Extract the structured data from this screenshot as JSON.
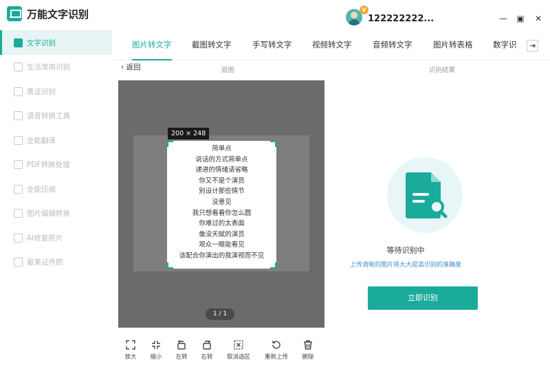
{
  "app": {
    "title": "万能文字识别"
  },
  "sidebar": {
    "items": [
      {
        "label": "文字识别",
        "icon": "text-recognition-icon",
        "active": true
      },
      {
        "label": "生活常用识别",
        "icon": "camera-icon"
      },
      {
        "label": "票证识别",
        "icon": "id-card-icon"
      },
      {
        "label": "语音转换工具",
        "icon": "audio-icon"
      },
      {
        "label": "全能翻译",
        "icon": "translate-icon"
      },
      {
        "label": "PDF转换处理",
        "icon": "pdf-icon"
      },
      {
        "label": "全能压缩",
        "icon": "compress-icon"
      },
      {
        "label": "图片编辑转换",
        "icon": "image-edit-icon"
      },
      {
        "label": "AI修复照片",
        "icon": "ai-repair-icon"
      },
      {
        "label": "最美证件照",
        "icon": "portrait-icon"
      }
    ]
  },
  "header": {
    "username": "122222222...",
    "vip_badge": "V",
    "window": {
      "minimize": "—",
      "maximize": "▣",
      "close": "✕"
    }
  },
  "tabs": {
    "items": [
      "图片转文字",
      "截图转文字",
      "手写转文字",
      "视频转文字",
      "音频转文字",
      "图片转表格",
      "数字识"
    ],
    "scroll": "⇥"
  },
  "subheader": {
    "back": "返回",
    "original_label": "原图",
    "result_label": "识别结果"
  },
  "image": {
    "dimensions": "200 × 248",
    "page_indicator": "1 / 1",
    "lines": [
      "简单点",
      "说话的方式简单点",
      "递进的情绪请省略",
      "你又不是个演员",
      "别设计那些情节",
      "没意见",
      "我只想看看你怎么圆",
      "你难过的太表面",
      "像没天赋的演员",
      "观众一眼能看见",
      "该配合你演出的我演视而不见"
    ]
  },
  "toolbar": [
    {
      "label": "放大",
      "icon": "zoom-in-icon"
    },
    {
      "label": "缩小",
      "icon": "zoom-out-icon"
    },
    {
      "label": "左转",
      "icon": "rotate-left-icon"
    },
    {
      "label": "右转",
      "icon": "rotate-right-icon"
    },
    {
      "label": "取消选区",
      "icon": "cancel-selection-icon"
    },
    {
      "label": "重新上传",
      "icon": "reupload-icon"
    },
    {
      "label": "删除",
      "icon": "delete-icon"
    }
  ],
  "result": {
    "status": "等待识别中",
    "hint": "上传清晰的图片将大大提高识别的准确度",
    "button": "立即识别"
  },
  "colors": {
    "accent": "#1aab9b",
    "hint": "#3e8cd0",
    "pane": "#6b6b6b"
  }
}
